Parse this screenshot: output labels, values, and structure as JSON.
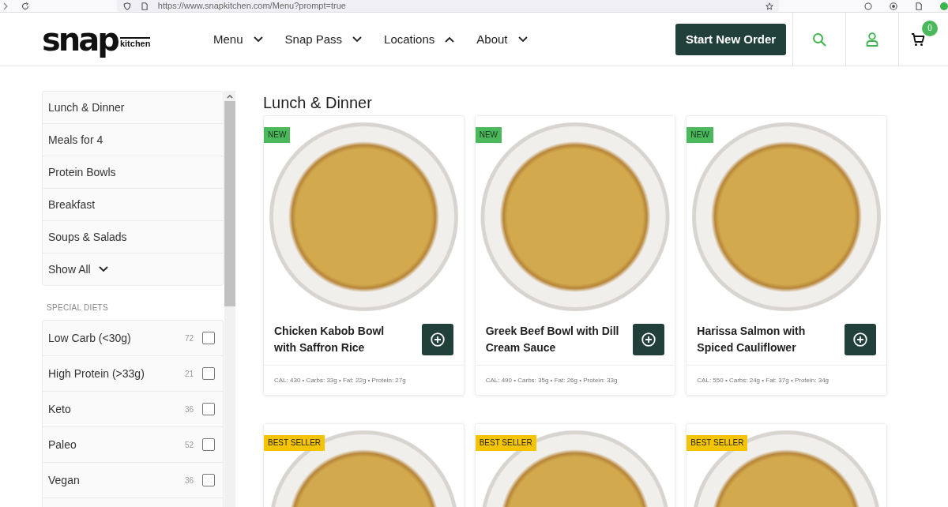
{
  "browser": {
    "url": "https://www.snapkitchen.com/Menu?prompt=true"
  },
  "header": {
    "logo": {
      "wordmark": "snap",
      "subtext": "kitchen"
    },
    "nav": [
      {
        "label": "Menu",
        "expanded": false
      },
      {
        "label": "Snap Pass",
        "expanded": false
      },
      {
        "label": "Locations",
        "expanded": true
      },
      {
        "label": "About",
        "expanded": false
      }
    ],
    "cta": "Start New Order",
    "cart_count": "0"
  },
  "sidebar": {
    "categories": [
      "Lunch & Dinner",
      "Meals for 4",
      "Protein Bowls",
      "Breakfast",
      "Soups & Salads"
    ],
    "show_all": {
      "label": "Show All",
      "expanded": false
    },
    "diets": {
      "heading": "SPECIAL DIETS",
      "items": [
        {
          "label": "Low Carb (<30g)",
          "count": "72",
          "checked": false
        },
        {
          "label": "High Protein (>33g)",
          "count": "21",
          "checked": false
        },
        {
          "label": "Keto",
          "count": "36",
          "checked": false
        },
        {
          "label": "Paleo",
          "count": "52",
          "checked": false
        },
        {
          "label": "Vegan",
          "count": "36",
          "checked": false
        }
      ]
    }
  },
  "main": {
    "heading": "Lunch & Dinner",
    "cards": [
      {
        "badge": {
          "kind": "new",
          "text": "NEW"
        },
        "title": "Chicken Kabob Bowl with Saffron Rice",
        "nutrition": "CAL: 430 • Carbs: 33g • Fat: 22g • Protein: 27g"
      },
      {
        "badge": {
          "kind": "new",
          "text": "NEW"
        },
        "title": "Greek Beef Bowl with Dill Cream Sauce",
        "nutrition": "CAL: 490 • Carbs: 35g • Fat: 26g • Protein: 33g"
      },
      {
        "badge": {
          "kind": "new",
          "text": "NEW"
        },
        "title": "Harissa Salmon with Spiced Cauliflower",
        "nutrition": "CAL: 550 • Carbs: 24g • Fat: 37g • Protein: 34g"
      },
      {
        "badge": {
          "kind": "best_seller",
          "text": "BEST SELLER"
        }
      },
      {
        "badge": {
          "kind": "best_seller",
          "text": "BEST SELLER"
        }
      },
      {
        "badge": {
          "kind": "best_seller",
          "text": "BEST SELLER"
        }
      }
    ]
  }
}
